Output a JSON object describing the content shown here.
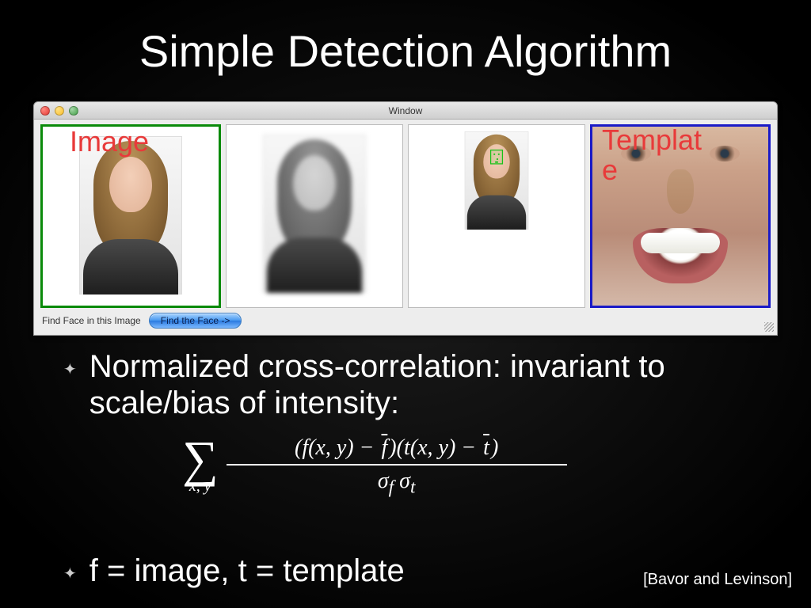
{
  "slide": {
    "title": "Simple Detection Algorithm",
    "image_label": "Image",
    "template_label": "Templat\ne",
    "bullet1": "Normalized cross-correlation: invariant to scale/bias of intensity:",
    "bullet2": "f = image, t = template",
    "citation": "[Bavor and Levinson]"
  },
  "window": {
    "title": "Window",
    "footer_link": "Find Face in this Image",
    "button_label": "Find the Face ->"
  },
  "formula": {
    "sum_sub": "x, y",
    "numerator": "(f(x, y) − f̄)(t(x, y) − t̄)",
    "denom_sigma_f": "σ",
    "denom_sub_f": "f",
    "denom_sigma_t": "σ",
    "denom_sub_t": "t"
  }
}
